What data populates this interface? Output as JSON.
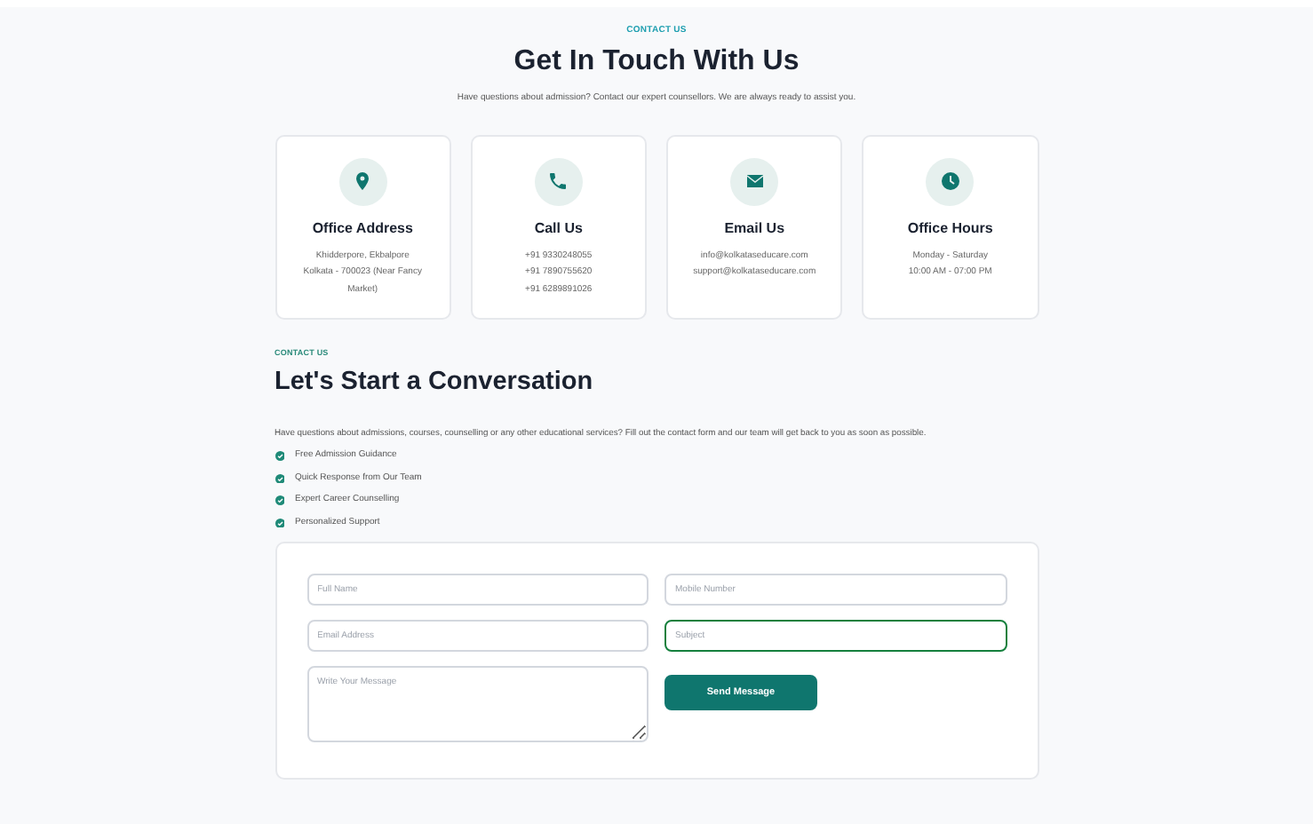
{
  "header": {
    "eyebrow": "CONTACT US",
    "title": "Get In Touch With Us",
    "subtitle": "Have questions about admission? Contact our expert counsellors. We are always ready to assist you."
  },
  "cards": [
    {
      "kind": "pin",
      "title": "Office Address",
      "lines": [
        "Khidderpore, Ekbalpore",
        "Kolkata - 700023 (Near Fancy",
        "Market)"
      ]
    },
    {
      "kind": "phone",
      "title": "Call Us",
      "lines": [
        "+91 9330248055",
        "+91 7890755620",
        "+91 6289891026"
      ]
    },
    {
      "kind": "mail",
      "title": "Email Us",
      "lines": [
        "info@kolkataseducare.com",
        "support@kolkataseducare.com"
      ]
    },
    {
      "kind": "clock",
      "title": "Office Hours",
      "lines": [
        "Monday - Saturday",
        "10:00 AM - 07:00 PM"
      ]
    }
  ],
  "conversation": {
    "eyebrow": "CONTACT US",
    "title": "Let's Start a Conversation",
    "text": "Have questions about admissions, courses, counselling or any other educational services? Fill out the contact form and our team will get back to you as soon as possible.",
    "features": [
      "Free Admission Guidance",
      "Quick Response from Our Team",
      "Expert Career Counselling",
      "Personalized Support"
    ]
  },
  "form": {
    "fields": [
      {
        "kind": "input",
        "placeholder": "Full Name",
        "focused": false
      },
      {
        "kind": "input",
        "placeholder": "Mobile Number",
        "focused": false
      },
      {
        "kind": "input",
        "placeholder": "Email Address",
        "focused": false
      },
      {
        "kind": "input",
        "placeholder": "Subject",
        "focused": true
      },
      {
        "kind": "textarea",
        "placeholder": "Write Your Message",
        "focused": false
      }
    ],
    "button": "Send Message"
  }
}
